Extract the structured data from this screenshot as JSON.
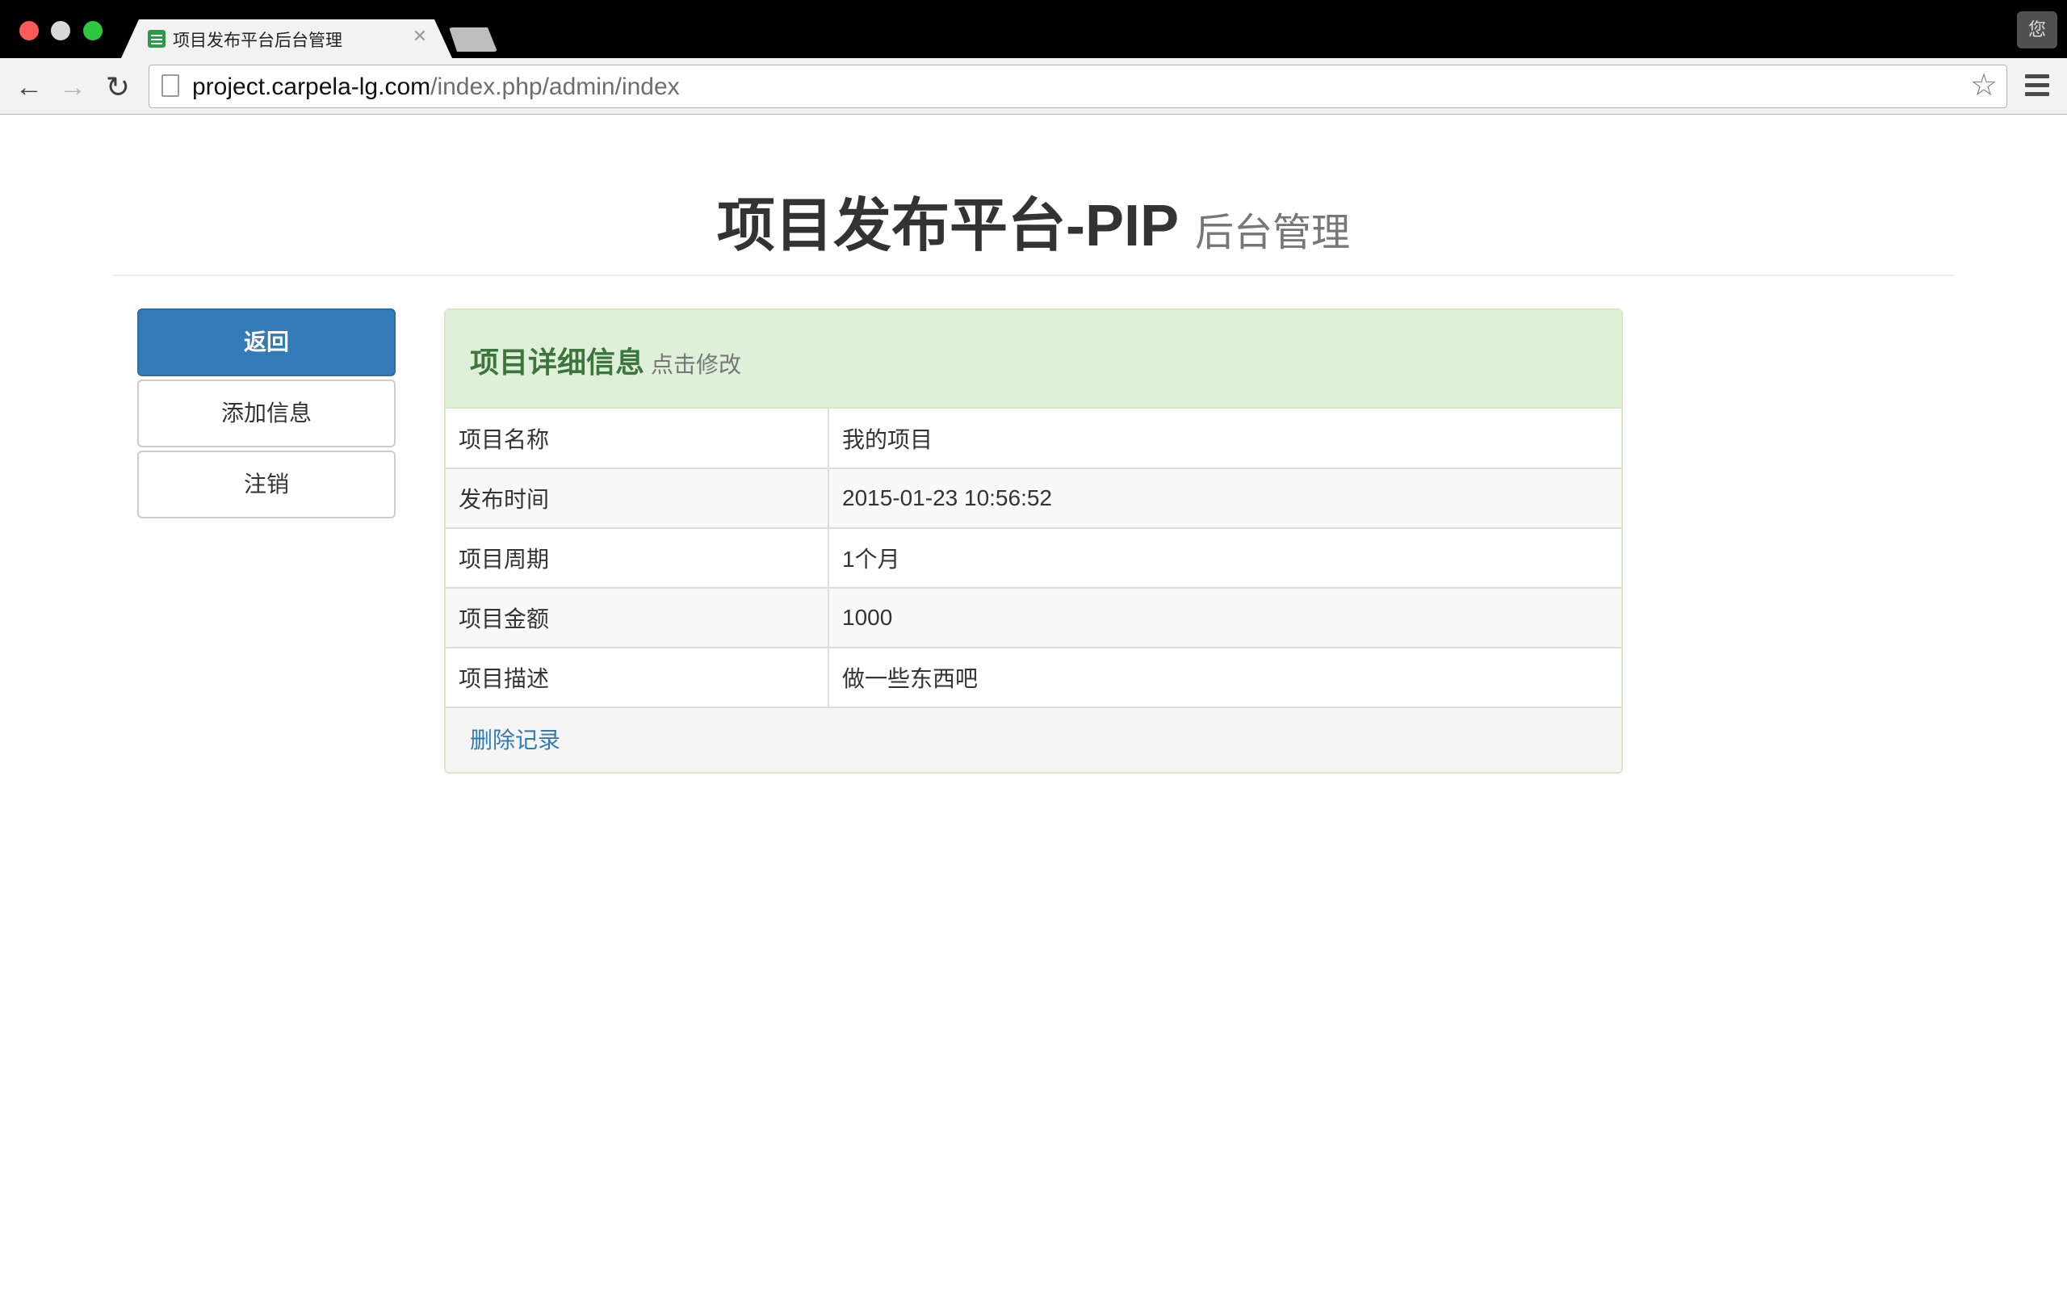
{
  "browser": {
    "tab_title": "项目发布平台后台管理",
    "tab_close": "✕",
    "profile_label": "您",
    "url_host": "project.carpela-lg.com",
    "url_path": "/index.php/admin/index"
  },
  "header": {
    "title": "项目发布平台-PIP",
    "subtitle": "后台管理"
  },
  "sidebar": {
    "items": [
      {
        "label": "返回",
        "active": true
      },
      {
        "label": "添加信息",
        "active": false
      },
      {
        "label": "注销",
        "active": false
      }
    ]
  },
  "panel": {
    "title": "项目详细信息",
    "subtitle": "点击修改",
    "rows": [
      {
        "key": "项目名称",
        "value": "我的项目"
      },
      {
        "key": "发布时间",
        "value": "2015-01-23 10:56:52"
      },
      {
        "key": "项目周期",
        "value": "1个月"
      },
      {
        "key": "项目金额",
        "value": "1000"
      },
      {
        "key": "项目描述",
        "value": "做一些东西吧"
      }
    ],
    "footer_link": "删除记录"
  },
  "colors": {
    "primary": "#337ab7",
    "panel_heading_bg": "#dff0d8",
    "panel_title": "#3c763d"
  }
}
